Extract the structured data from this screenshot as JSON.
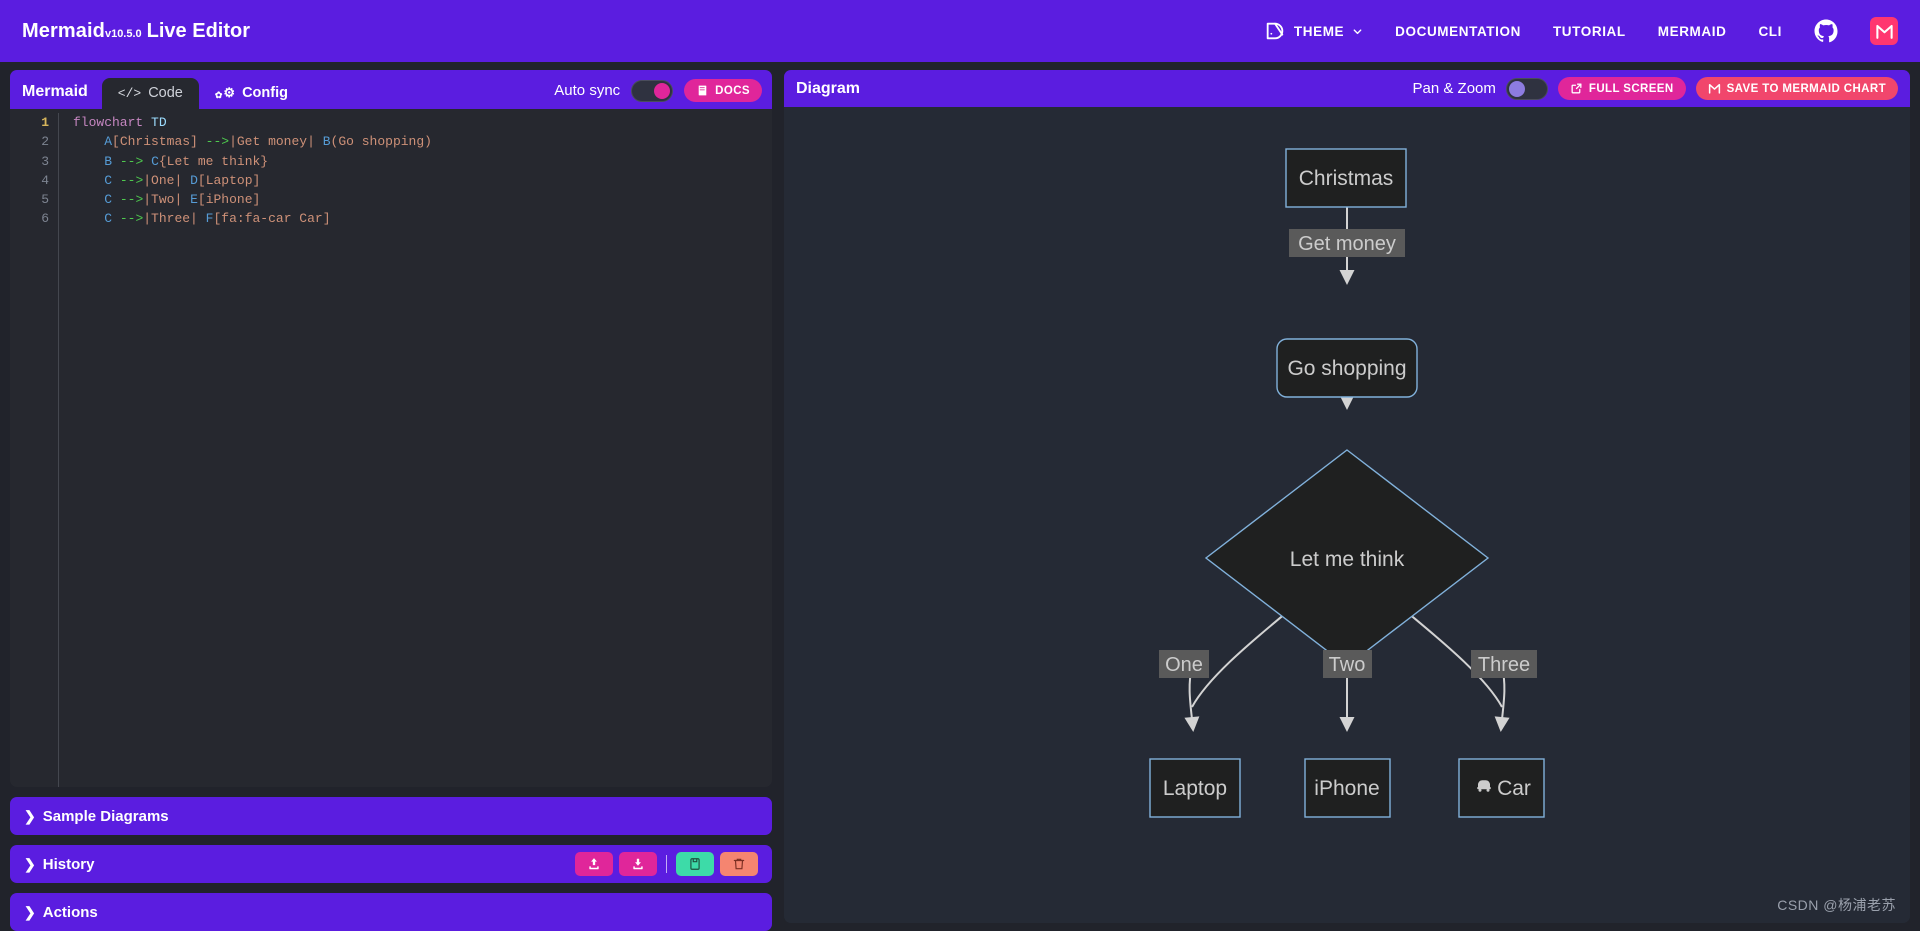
{
  "header": {
    "brand_name": "Mermaid",
    "brand_version": "v10.5.0",
    "brand_suffix": "Live Editor",
    "nav": [
      {
        "label": "THEME",
        "icon": "theme-icon",
        "has_dropdown": true
      },
      {
        "label": "DOCUMENTATION",
        "icon": "",
        "has_dropdown": false
      },
      {
        "label": "TUTORIAL",
        "icon": "",
        "has_dropdown": false
      },
      {
        "label": "MERMAID",
        "icon": "",
        "has_dropdown": false
      },
      {
        "label": "CLI",
        "icon": "",
        "has_dropdown": false
      }
    ],
    "github_icon": "github-icon",
    "mermaid_chart_icon": "mermaid-chart-logo",
    "accent": "#5b1de0"
  },
  "editor": {
    "panel_label": "Mermaid",
    "tabs": [
      {
        "label": "Code",
        "icon": "code-icon",
        "active": true
      },
      {
        "label": "Config",
        "icon": "gears-icon",
        "active": false
      }
    ],
    "auto_sync_label": "Auto sync",
    "auto_sync_on": true,
    "docs_label": "DOCS",
    "code": {
      "line_count": 6,
      "current_line": 1,
      "lines": [
        "flowchart TD",
        "    A[Christmas] -->|Get money| B(Go shopping)",
        "    B --> C{Let me think}",
        "    C -->|One| D[Laptop]",
        "    C -->|Two| E[iPhone]",
        "    C -->|Three| F[fa:fa-car Car]"
      ]
    }
  },
  "panels": [
    {
      "label": "Sample Diagrams",
      "expanded": false,
      "buttons": []
    },
    {
      "label": "History",
      "expanded": false,
      "buttons": [
        {
          "name": "upload-button",
          "icon": "upload-icon",
          "color": "#e0269a"
        },
        {
          "name": "download-button",
          "icon": "download-icon",
          "color": "#e0269a"
        },
        {
          "name": "save-button",
          "icon": "save-icon",
          "color": "#3ddba8"
        },
        {
          "name": "delete-button",
          "icon": "trash-icon",
          "color": "#f58570"
        }
      ]
    },
    {
      "label": "Actions",
      "expanded": false,
      "buttons": []
    }
  ],
  "diagram": {
    "title": "Diagram",
    "pan_zoom_label": "Pan & Zoom",
    "pan_zoom_on": false,
    "full_screen_label": "FULL SCREEN",
    "save_chart_label": "SAVE TO MERMAID CHART",
    "node_fill": "#1f2020",
    "node_stroke": "#81b1db",
    "edge_color": "#d3d3d3",
    "label_bg": "#5a5a5a",
    "text_color": "#cccccc",
    "nodes": [
      {
        "id": "A",
        "text": "Christmas",
        "shape": "rect"
      },
      {
        "id": "B",
        "text": "Go shopping",
        "shape": "round"
      },
      {
        "id": "C",
        "text": "Let me think",
        "shape": "diamond"
      },
      {
        "id": "D",
        "text": "Laptop",
        "shape": "rect"
      },
      {
        "id": "E",
        "text": "iPhone",
        "shape": "rect"
      },
      {
        "id": "F",
        "text": "Car",
        "shape": "rect",
        "icon": "car-icon"
      }
    ],
    "edges": [
      {
        "from": "A",
        "to": "B",
        "label": "Get money"
      },
      {
        "from": "B",
        "to": "C",
        "label": ""
      },
      {
        "from": "C",
        "to": "D",
        "label": "One"
      },
      {
        "from": "C",
        "to": "E",
        "label": "Two"
      },
      {
        "from": "C",
        "to": "F",
        "label": "Three"
      }
    ]
  },
  "watermark": "CSDN @杨浦老苏"
}
